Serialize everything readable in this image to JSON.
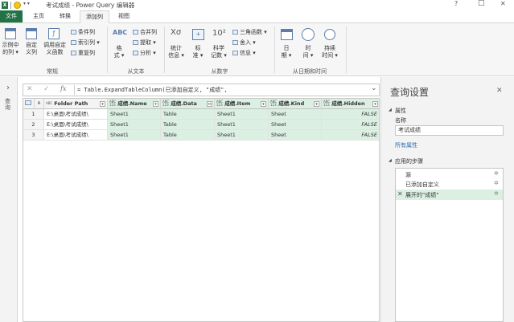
{
  "app": {
    "title": "考试成绩 - Power Query 编辑器",
    "window_controls": [
      "?",
      "□",
      "✕"
    ]
  },
  "tabs": {
    "file": "文件",
    "home": "主页",
    "transform": "转换",
    "add_column": "添加列",
    "view": "视图"
  },
  "ribbon": {
    "general": {
      "example_column": "示例中\n的列 ▾",
      "custom_column": "自定\n义列",
      "invoke_function": "调用自定\n义函数",
      "conditional_column": "条件列",
      "index_column": "索引列 ▾",
      "duplicate_column": "重复列",
      "label": "常规"
    },
    "text": {
      "format": "格\n式 ▾",
      "merge": "合并列",
      "extract": "提取 ▾",
      "parse": "分析 ▾",
      "label": "从文本"
    },
    "number": {
      "statistics": "统计\n信息 ▾",
      "standard": "标\n准 ▾",
      "scientific": "科学\n记数 ▾",
      "trig": "三角函数 ▾",
      "rounding": "舍入 ▾",
      "info": "信息 ▾",
      "label": "从数字"
    },
    "datetime": {
      "date": "日\n期 ▾",
      "time": "时\n间 ▾",
      "duration": "持续\n时间 ▾",
      "label": "从日期和时间"
    }
  },
  "nav": {
    "arrow": "›",
    "label": "查\n询"
  },
  "formula_bar": {
    "cancel": "✕",
    "confirm": "✓",
    "fx": "fx",
    "formula": "= Table.ExpandTableColumn(已添加自定义, \"成绩\",",
    "expand": "⌄"
  },
  "grid": {
    "columns": [
      {
        "name": "Folder Path",
        "type": "ABC"
      },
      {
        "name": "成绩.Name",
        "type": "ABC\n123"
      },
      {
        "name": "成绩.Data",
        "type": "ABC\n123"
      },
      {
        "name": "成绩.Item",
        "type": "ABC\n123"
      },
      {
        "name": "成绩.Kind",
        "type": "ABC\n123"
      },
      {
        "name": "成绩.Hidden",
        "type": "ABC\n123"
      }
    ],
    "rows": [
      {
        "num": "1",
        "path": "E:\\桌面\\考试成绩\\",
        "name": "Sheet1",
        "data": "Table",
        "item": "Sheet1",
        "kind": "Sheet",
        "hidden": "FALSE"
      },
      {
        "num": "2",
        "path": "E:\\桌面\\考试成绩\\",
        "name": "Sheet1",
        "data": "Table",
        "item": "Sheet1",
        "kind": "Sheet",
        "hidden": "FALSE"
      },
      {
        "num": "3",
        "path": "E:\\桌面\\考试成绩\\",
        "name": "Sheet1",
        "data": "Table",
        "item": "Sheet1",
        "kind": "Sheet",
        "hidden": "FALSE"
      }
    ]
  },
  "query_settings": {
    "title": "查询设置",
    "close": "✕",
    "properties_heading": "属性",
    "name_label": "名称",
    "name_value": "考试成绩",
    "all_properties": "所有属性",
    "steps_heading": "应用的步骤",
    "steps": [
      "源",
      "已添加自定义",
      "展开的\"成绩\""
    ]
  },
  "colors": {
    "accent": "#217346",
    "selected_row": "#dbf0e2",
    "link": "#2f6fb5"
  }
}
